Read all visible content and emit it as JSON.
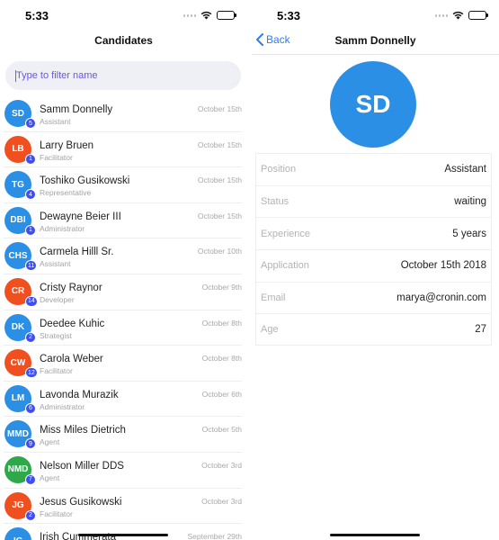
{
  "left": {
    "status_time": "5:33",
    "title": "Candidates",
    "search": {
      "placeholder": "Type to filter name"
    },
    "candidates": [
      {
        "initials": "SD",
        "name": "Samm Donnelly",
        "role": "Assistant",
        "date": "October 15th",
        "count": "5",
        "color": "#2b8fe6"
      },
      {
        "initials": "LB",
        "name": "Larry Bruen",
        "role": "Facilitator",
        "date": "October 15th",
        "count": "1",
        "color": "#f0501f"
      },
      {
        "initials": "TG",
        "name": "Toshiko Gusikowski",
        "role": "Representative",
        "date": "October 15th",
        "count": "4",
        "color": "#2b8fe6"
      },
      {
        "initials": "DBI",
        "name": "Dewayne Beier III",
        "role": "Administrator",
        "date": "October 15th",
        "count": "1",
        "color": "#2b8fe6"
      },
      {
        "initials": "CHS",
        "name": "Carmela Hilll Sr.",
        "role": "Assistant",
        "date": "October 10th",
        "count": "11",
        "color": "#2b8fe6"
      },
      {
        "initials": "CR",
        "name": "Cristy Raynor",
        "role": "Developer",
        "date": "October 9th",
        "count": "14",
        "color": "#f0501f"
      },
      {
        "initials": "DK",
        "name": "Deedee Kuhic",
        "role": "Strategist",
        "date": "October 8th",
        "count": "2",
        "color": "#2b8fe6"
      },
      {
        "initials": "CW",
        "name": "Carola Weber",
        "role": "Facilitator",
        "date": "October 8th",
        "count": "12",
        "color": "#f0501f"
      },
      {
        "initials": "LM",
        "name": "Lavonda Murazik",
        "role": "Administrator",
        "date": "October 6th",
        "count": "6",
        "color": "#2b8fe6"
      },
      {
        "initials": "MMD",
        "name": "Miss Miles Dietrich",
        "role": "Agent",
        "date": "October 5th",
        "count": "9",
        "color": "#2b8fe6"
      },
      {
        "initials": "NMD",
        "name": "Nelson Miller DDS",
        "role": "Agent",
        "date": "October 3rd",
        "count": "7",
        "color": "#2ea84a"
      },
      {
        "initials": "JG",
        "name": "Jesus Gusikowski",
        "role": "Facilitator",
        "date": "October 3rd",
        "count": "2",
        "color": "#f0501f"
      },
      {
        "initials": "IC",
        "name": "Irish Cummerata",
        "role": "",
        "date": "September 29th",
        "count": "",
        "color": "#2b8fe6"
      }
    ]
  },
  "right": {
    "status_time": "5:33",
    "back_label": "Back",
    "title": "Samm Donnelly",
    "initials": "SD",
    "details": [
      {
        "label": "Position",
        "value": "Assistant"
      },
      {
        "label": "Status",
        "value": "waiting"
      },
      {
        "label": "Experience",
        "value": "5 years"
      },
      {
        "label": "Application",
        "value": "October 15th 2018"
      },
      {
        "label": "Email",
        "value": "marya@cronin.com"
      },
      {
        "label": "Age",
        "value": "27"
      }
    ]
  },
  "colors": {
    "accent": "#2f7cf6",
    "badge": "#3d4ef2",
    "avatar_blue": "#2b8fe6",
    "avatar_orange": "#f0501f",
    "avatar_green": "#2ea84a"
  },
  "icons": [
    "wifi-icon",
    "battery-icon",
    "signal-icon",
    "chevron-left-icon"
  ]
}
